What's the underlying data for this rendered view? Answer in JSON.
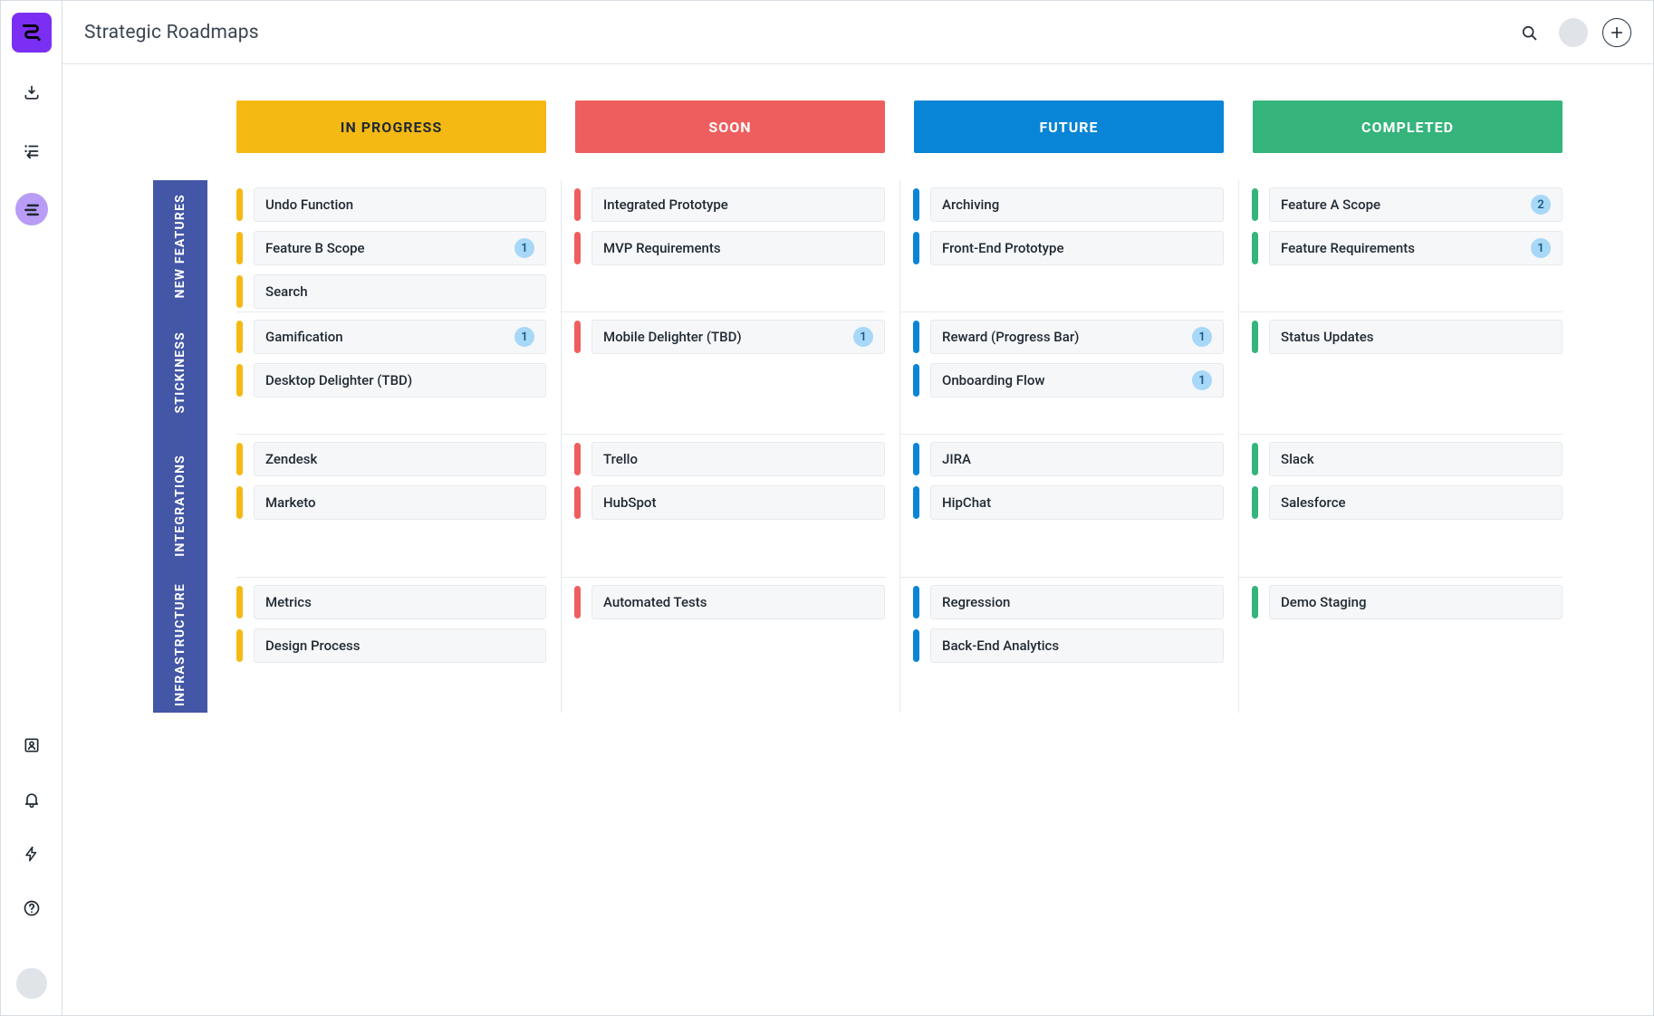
{
  "page_title": "Strategic Roadmaps",
  "colors": {
    "brand": "#7b2ff2",
    "in_progress": "#f5b914",
    "soon": "#ef5e5e",
    "future": "#0885d6",
    "completed": "#35b47b",
    "badge_bg": "#a7d8f7",
    "swimlane": "#4456a6"
  },
  "columns": [
    {
      "id": "in_progress",
      "label": "IN PROGRESS"
    },
    {
      "id": "soon",
      "label": "SOON"
    },
    {
      "id": "future",
      "label": "FUTURE"
    },
    {
      "id": "completed",
      "label": "COMPLETED"
    }
  ],
  "lanes": [
    {
      "id": "new_features",
      "label": "NEW FEATURES",
      "cells": {
        "in_progress": [
          {
            "title": "Undo Function"
          },
          {
            "title": "Feature B Scope",
            "badge": "1"
          },
          {
            "title": "Search"
          }
        ],
        "soon": [
          {
            "title": "Integrated Prototype"
          },
          {
            "title": "MVP Requirements"
          }
        ],
        "future": [
          {
            "title": "Archiving"
          },
          {
            "title": "Front-End Prototype"
          }
        ],
        "completed": [
          {
            "title": "Feature A Scope",
            "badge": "2"
          },
          {
            "title": "Feature Requirements",
            "badge": "1"
          }
        ]
      }
    },
    {
      "id": "stickiness",
      "label": "STICKINESS",
      "cells": {
        "in_progress": [
          {
            "title": "Gamification",
            "badge": "1"
          },
          {
            "title": "Desktop Delighter (TBD)"
          }
        ],
        "soon": [
          {
            "title": "Mobile Delighter (TBD)",
            "badge": "1"
          }
        ],
        "future": [
          {
            "title": "Reward (Progress Bar)",
            "badge": "1"
          },
          {
            "title": "Onboarding Flow",
            "badge": "1"
          }
        ],
        "completed": [
          {
            "title": "Status Updates"
          }
        ]
      }
    },
    {
      "id": "integrations",
      "label": "INTEGRATIONS",
      "cells": {
        "in_progress": [
          {
            "title": "Zendesk"
          },
          {
            "title": "Marketo"
          }
        ],
        "soon": [
          {
            "title": "Trello"
          },
          {
            "title": "HubSpot"
          }
        ],
        "future": [
          {
            "title": "JIRA"
          },
          {
            "title": "HipChat"
          }
        ],
        "completed": [
          {
            "title": "Slack"
          },
          {
            "title": "Salesforce"
          }
        ]
      }
    },
    {
      "id": "infrastructure",
      "label": "INFRASTRUCTURE",
      "cells": {
        "in_progress": [
          {
            "title": "Metrics"
          },
          {
            "title": "Design Process"
          }
        ],
        "soon": [
          {
            "title": "Automated Tests"
          }
        ],
        "future": [
          {
            "title": "Regression"
          },
          {
            "title": "Back-End Analytics"
          }
        ],
        "completed": [
          {
            "title": "Demo Staging"
          }
        ]
      }
    }
  ]
}
